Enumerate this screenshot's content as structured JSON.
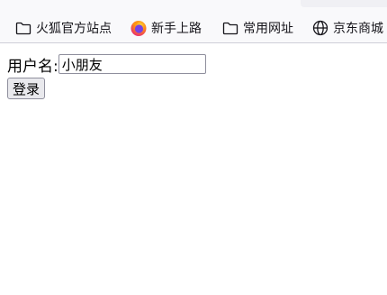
{
  "bookmarks": [
    {
      "label": "火狐官方站点",
      "icon": "folder-icon"
    },
    {
      "label": "新手上路",
      "icon": "firefox-icon"
    },
    {
      "label": "常用网址",
      "icon": "folder-icon"
    },
    {
      "label": "京东商城",
      "icon": "globe-icon"
    }
  ],
  "form": {
    "username_label": "用户名:",
    "username_value": "小朋友",
    "login_label": "登录"
  }
}
